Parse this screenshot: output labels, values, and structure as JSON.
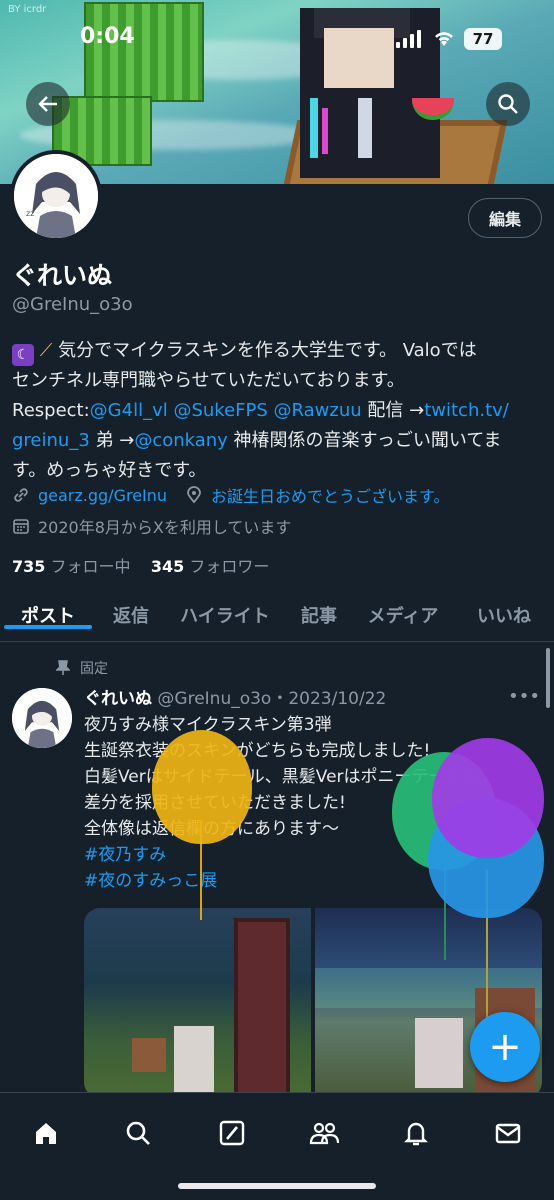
{
  "status_bar": {
    "time": "0:04",
    "battery": "77"
  },
  "banner": {
    "watermark": "BY icrdr"
  },
  "profile": {
    "edit_label": "編集",
    "name": "ぐれいぬ",
    "handle": "@GreInu_o3o",
    "bio": {
      "line1": "気分でマイクラスキンを作る大学生です。 Valoでは",
      "line2": "センチネル専門職やらせていただいております。",
      "respect_label": "Respect:",
      "mention1": "@G4ll_vl",
      "mention2": "@SukeFPS",
      "mention3": "@Rawzuu",
      "haishin": " 配信 →",
      "twitch_link": "twitch.tv/",
      "twitch_link2": "greinu_3",
      "brother": " 弟 →",
      "mention4": "@conkany",
      "tail1": " 神椿関係の音楽すっごい聞いてま",
      "tail2": "す。めっちゃ好きです。"
    },
    "website": "gearz.gg/GreInu",
    "location": "お誕生日おめでとうございます。",
    "joined": "2020年8月からXを利用しています",
    "following_count": "735",
    "following_label": "フォロー中",
    "followers_count": "345",
    "followers_label": "フォロワー"
  },
  "tabs": [
    "ポスト",
    "返信",
    "ハイライト",
    "記事",
    "メディア",
    "いいね"
  ],
  "post": {
    "pinned_label": "固定",
    "author_name": "ぐれいぬ",
    "author_handle": "@GreInu_o3o",
    "date": "・2023/10/22",
    "line1": "夜乃すみ様マイクラスキン第3弾",
    "line2": "生誕祭衣装のスキンがどちらも完成しました!",
    "line3": "白髪Verはサイドテール、黒髪Verはポニーテールの",
    "line4": "差分を採用させていただきました!",
    "line5": "全体像は返信欄の方にあります〜",
    "hashtag1": "#夜乃すみ",
    "hashtag2": "#夜のすみっこ展"
  },
  "fab_label": "+",
  "bottom_nav": [
    "home-icon",
    "search-icon",
    "grok-icon",
    "communities-icon",
    "notifications-icon",
    "messages-icon"
  ],
  "colors": {
    "accent": "#1d9bf0",
    "background": "#15202b",
    "muted": "#8b98a5"
  }
}
